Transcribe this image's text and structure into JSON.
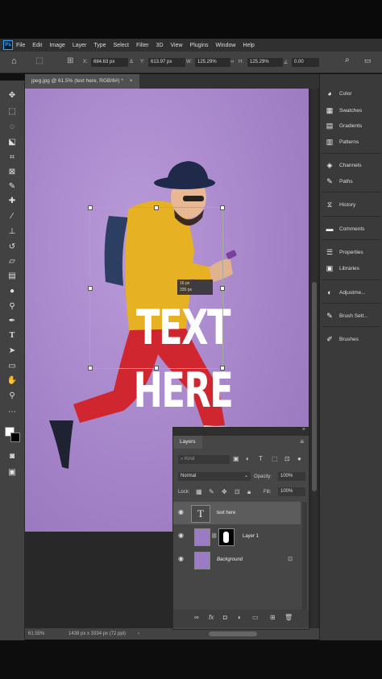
{
  "app": {
    "logo": "Ps"
  },
  "menu": [
    "File",
    "Edit",
    "Image",
    "Layer",
    "Type",
    "Select",
    "Filter",
    "3D",
    "View",
    "Plugins",
    "Window",
    "Help"
  ],
  "options": {
    "x_label": "X:",
    "x_value": "684.63 px",
    "y_label": "Y:",
    "y_value": "613.97 px",
    "w_label": "W:",
    "w_value": "125.29%",
    "h_label": "H:",
    "h_value": "125.29%",
    "angle_value": "0.00"
  },
  "document": {
    "tab_title": "jpeg.jpg @ 61.5% (text here, RGB/8#) *"
  },
  "canvas": {
    "text_line1": "TEXT",
    "text_line2": "HERE",
    "measure_line1": "16 px",
    "measure_line2": "335 px"
  },
  "status": {
    "zoom": "61.55%",
    "doc_size": "1438 px x 3334 px (72 ppi)"
  },
  "right_panel": [
    {
      "label": "Color",
      "icon": "color-icon"
    },
    {
      "label": "Swatches",
      "icon": "swatches-icon"
    },
    {
      "label": "Gradients",
      "icon": "gradients-icon"
    },
    {
      "label": "Patterns",
      "icon": "patterns-icon"
    },
    {
      "label": "Channels",
      "icon": "channels-icon"
    },
    {
      "label": "Paths",
      "icon": "paths-icon"
    },
    {
      "label": "History",
      "icon": "history-icon"
    },
    {
      "label": "Comments",
      "icon": "comments-icon"
    },
    {
      "label": "Properties",
      "icon": "properties-icon"
    },
    {
      "label": "Libraries",
      "icon": "libraries-icon"
    },
    {
      "label": "Adjustme...",
      "icon": "adjustments-icon"
    },
    {
      "label": "Brush Sett...",
      "icon": "brush-settings-icon"
    },
    {
      "label": "Brushes",
      "icon": "brushes-icon"
    }
  ],
  "layers_panel": {
    "title": "Layers",
    "search_placeholder": "Kind",
    "blend_mode": "Normal",
    "opacity_label": "Opacity:",
    "opacity_value": "100%",
    "lock_label": "Lock:",
    "fill_label": "Fill:",
    "fill_value": "100%",
    "layers": [
      {
        "name": "text here",
        "type": "text"
      },
      {
        "name": "Layer 1",
        "type": "image-mask"
      },
      {
        "name": "Background",
        "type": "background"
      }
    ]
  },
  "colors": {
    "canvas_bg": "#a584c9",
    "shirt": "#e6b122",
    "pants": "#d0262f",
    "hat": "#1f2a4a"
  }
}
